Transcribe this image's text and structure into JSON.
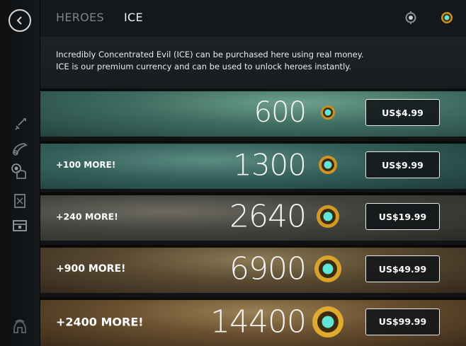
{
  "tabs": [
    {
      "label": "HEROES",
      "active": false
    },
    {
      "label": "ICE",
      "active": true
    }
  ],
  "top_icons": [
    "settings-gem-icon",
    "ice-currency-icon"
  ],
  "sidebar_icons": [
    "sword-icon",
    "horn-icon",
    "helmet-icon",
    "scroll-icon",
    "chest-icon",
    "spartan-helmet-icon"
  ],
  "info": {
    "line1": "Incredibly Concentrated Evil (ICE) can be purchased here using real money.",
    "line2": "ICE is our premium currency and can be used to unlock heroes instantly."
  },
  "offers": [
    {
      "bonus": "",
      "amount": "600",
      "price": "US$4.99"
    },
    {
      "bonus": "+100 MORE!",
      "amount": "1300",
      "price": "US$9.99"
    },
    {
      "bonus": "+240 MORE!",
      "amount": "2640",
      "price": "US$19.99"
    },
    {
      "bonus": "+900 MORE!",
      "amount": "6900",
      "price": "US$49.99"
    },
    {
      "bonus": "+2400 MORE!",
      "amount": "14400",
      "price": "US$99.99"
    }
  ],
  "colors": {
    "gold": "#d9a72a",
    "gem": "#4fe0d0",
    "row_backgrounds": [
      "#3b6a5e",
      "#2f5a55",
      "#4a4a44",
      "#5a4a32",
      "#6a5030"
    ]
  }
}
